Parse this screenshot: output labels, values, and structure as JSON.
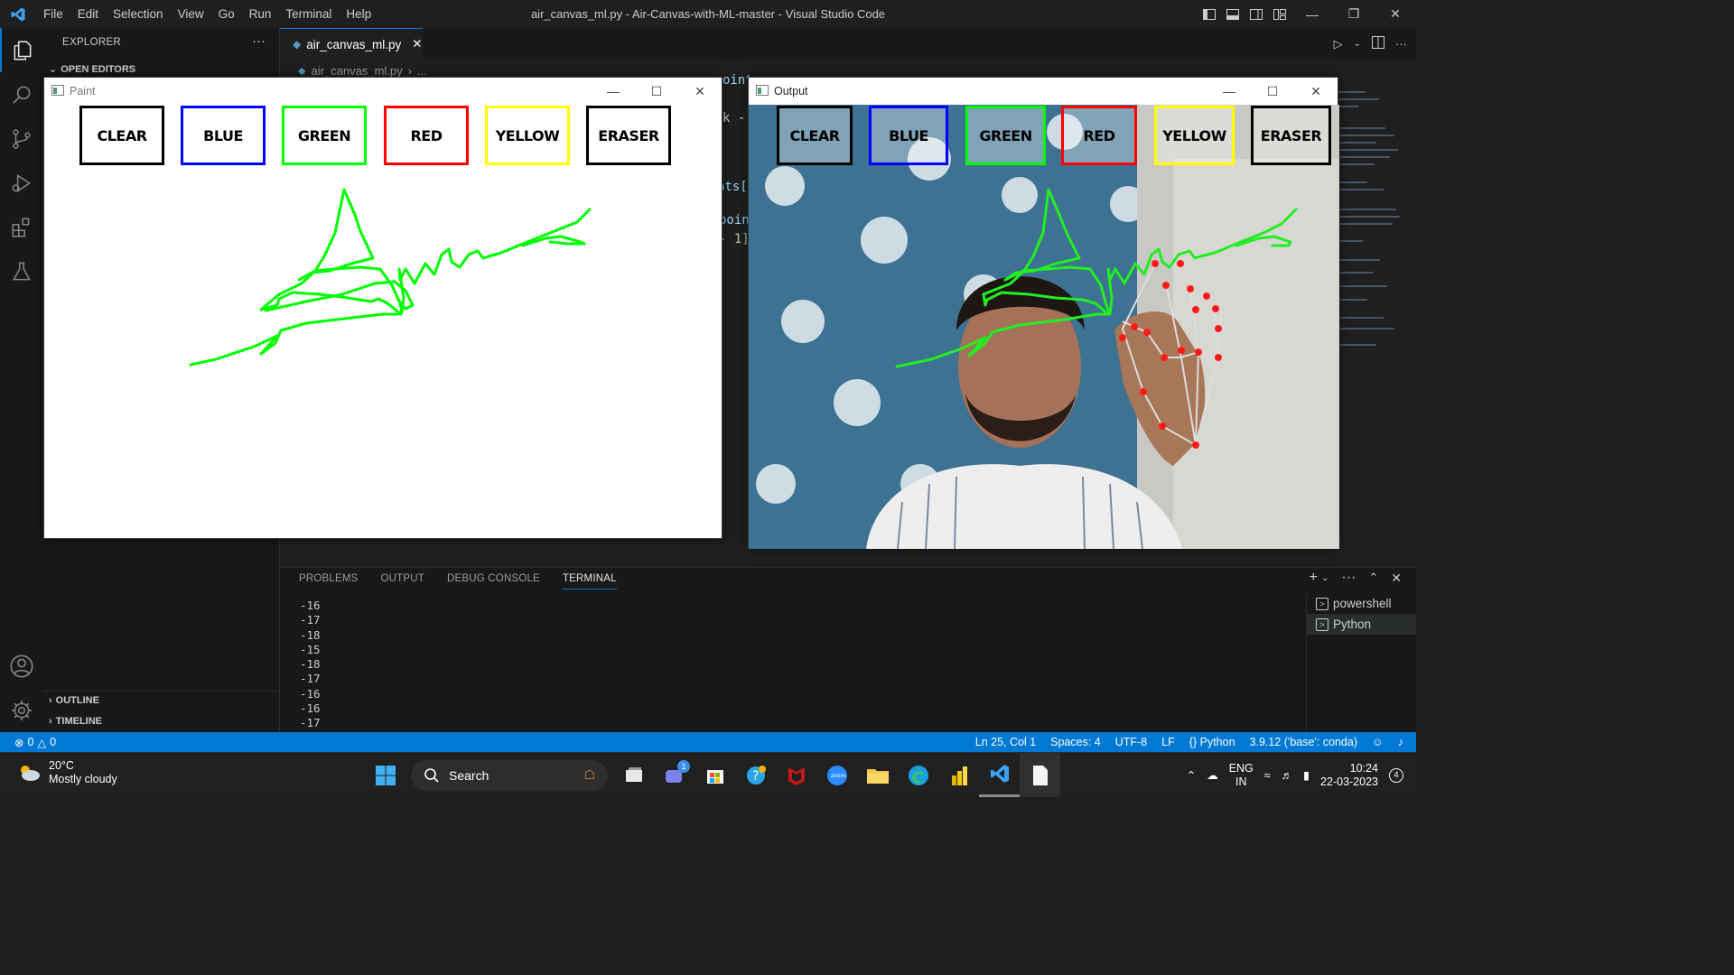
{
  "titlebar": {
    "menu": [
      "File",
      "Edit",
      "Selection",
      "View",
      "Go",
      "Run",
      "Terminal",
      "Help"
    ],
    "window_title": "air_canvas_ml.py - Air-Canvas-with-ML-master - Visual Studio Code"
  },
  "activity_bar": {
    "items": [
      "explorer-icon",
      "search-icon",
      "source-control-icon",
      "run-debug-icon",
      "extensions-icon",
      "testing-icon"
    ],
    "bottom": [
      "account-icon",
      "settings-gear-icon"
    ]
  },
  "sidebar": {
    "title": "EXPLORER",
    "more": "···",
    "open_editors": "OPEN EDITORS",
    "outline": "OUTLINE",
    "timeline": "TIMELINE"
  },
  "editor": {
    "tab_label": "air_canvas_ml.py",
    "breadcrumb_file": "air_canvas_ml.py",
    "breadcrumb_more": "...",
    "fragments": [
      "oint",
      "k -",
      "nts[",
      "poin",
      "- 1]"
    ]
  },
  "paint_window": {
    "title": "Paint",
    "buttons": [
      {
        "label": "CLEAR",
        "color": "#000000"
      },
      {
        "label": "BLUE",
        "color": "#0000ff"
      },
      {
        "label": "GREEN",
        "color": "#00ff00"
      },
      {
        "label": "RED",
        "color": "#ff0000"
      },
      {
        "label": "YELLOW",
        "color": "#ffff00"
      },
      {
        "label": "ERASER",
        "color": "#000000"
      }
    ],
    "stroke_color": "#00ff00"
  },
  "output_window": {
    "title": "Output",
    "buttons": [
      {
        "label": "CLEAR",
        "color": "#000000"
      },
      {
        "label": "BLUE",
        "color": "#0000ff"
      },
      {
        "label": "GREEN",
        "color": "#00ff00"
      },
      {
        "label": "RED",
        "color": "#ff0000"
      },
      {
        "label": "YELLOW",
        "color": "#ffff00"
      },
      {
        "label": "ERASER",
        "color": "#000000"
      }
    ],
    "landmark_color": "#ff0000"
  },
  "panel": {
    "tabs": [
      "PROBLEMS",
      "OUTPUT",
      "DEBUG CONSOLE",
      "TERMINAL"
    ],
    "active_tab": "TERMINAL",
    "terminal_lines": [
      "-16",
      "-17",
      "-18",
      "-15",
      "-18",
      "-17",
      "-16",
      "-16",
      "-17"
    ],
    "terminals": [
      "powershell",
      "Python"
    ]
  },
  "statusbar": {
    "errors": "0",
    "warnings": "0",
    "position": "Ln 25, Col 1",
    "spaces": "Spaces: 4",
    "encoding": "UTF-8",
    "eol": "LF",
    "language": "Python",
    "interpreter": "3.9.12 ('base': conda)"
  },
  "taskbar": {
    "temperature": "20°C",
    "weather": "Mostly cloudy",
    "search": "Search",
    "teams_badge": "1",
    "lang_top": "ENG",
    "lang_bottom": "IN",
    "time": "10:24",
    "date": "22-03-2023",
    "notifications": "4"
  },
  "colors": {
    "accent": "#0078d4",
    "statusbar": "#0078d4"
  }
}
